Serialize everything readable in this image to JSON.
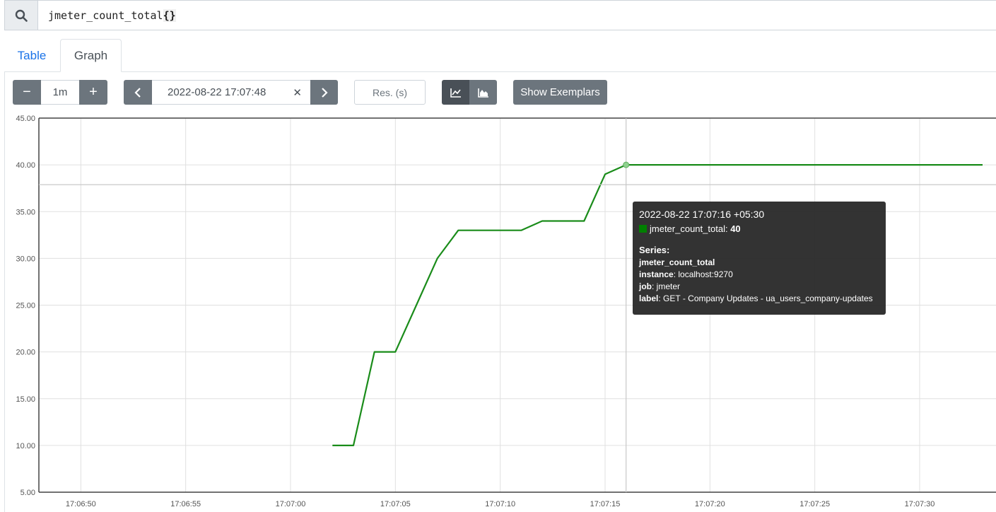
{
  "query": {
    "text": "jmeter_count_total",
    "braces": "{}"
  },
  "tabs": [
    {
      "label": "Table",
      "active": false
    },
    {
      "label": "Graph",
      "active": true
    }
  ],
  "controls": {
    "minus": "−",
    "range": "1m",
    "plus": "+",
    "prev": "‹",
    "end_time": "2022-08-22 17:07:48",
    "clear": "✕",
    "next": "›",
    "resolution_placeholder": "Res. (s)",
    "stacked_line_icon": "line-chart-icon",
    "stacked_area_icon": "area-chart-icon",
    "exemplars": "Show Exemplars"
  },
  "chart_data": {
    "type": "line",
    "ylim": [
      5,
      45
    ],
    "yticks": [
      "45.00",
      "40.00",
      "35.00",
      "30.00",
      "25.00",
      "20.00",
      "15.00",
      "10.00",
      "5.00"
    ],
    "xticks": [
      "17:06:50",
      "17:06:55",
      "17:07:00",
      "17:07:05",
      "17:07:10",
      "17:07:15",
      "17:07:20",
      "17:07:25",
      "17:07:30"
    ],
    "x_range": [
      "17:06:48",
      "17:07:33"
    ],
    "color": "#1a8c1a",
    "series": [
      {
        "name": "jmeter_count_total",
        "x": [
          "17:07:02",
          "17:07:03",
          "17:07:04",
          "17:07:05",
          "17:07:06",
          "17:07:07",
          "17:07:08",
          "17:07:09",
          "17:07:10",
          "17:07:11",
          "17:07:12",
          "17:07:13",
          "17:07:14",
          "17:07:15",
          "17:07:16",
          "17:07:17",
          "17:07:18",
          "17:07:19",
          "17:07:20",
          "17:07:21",
          "17:07:22",
          "17:07:23",
          "17:07:24",
          "17:07:25",
          "17:07:26",
          "17:07:27",
          "17:07:28",
          "17:07:29",
          "17:07:30",
          "17:07:31",
          "17:07:32",
          "17:07:33"
        ],
        "values": [
          10,
          10,
          20,
          20,
          25,
          30,
          33,
          33,
          33,
          33,
          34,
          34,
          34,
          39,
          40,
          40,
          40,
          40,
          40,
          40,
          40,
          40,
          40,
          40,
          40,
          40,
          40,
          40,
          40,
          40,
          40,
          40
        ]
      }
    ],
    "hover": {
      "x": "17:07:16",
      "y": 40
    }
  },
  "tooltip": {
    "date": "2022-08-22 17:07:16 +05:30",
    "series_name": "jmeter_count_total",
    "value": "40",
    "series_heading": "Series:",
    "metric": "jmeter_count_total",
    "labels": [
      {
        "key": "instance",
        "value": "localhost:9270"
      },
      {
        "key": "job",
        "value": "jmeter"
      },
      {
        "key": "label",
        "value": "GET - Company Updates - ua_users_company-updates"
      }
    ]
  }
}
